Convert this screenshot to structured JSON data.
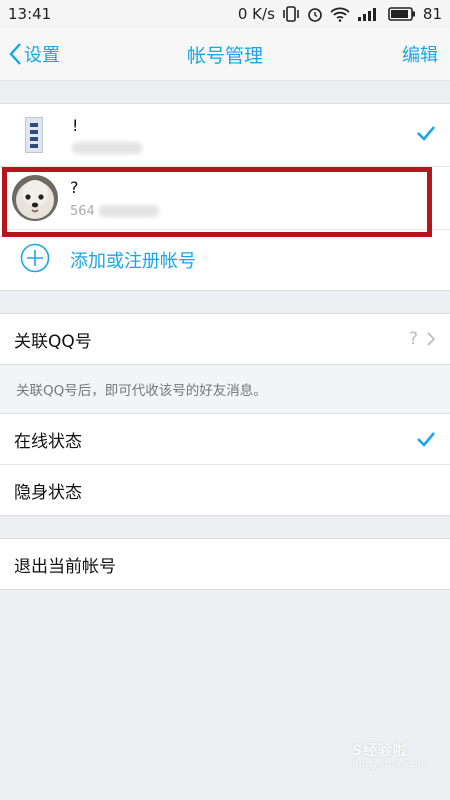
{
  "status_bar": {
    "time": "13:41",
    "network_speed": "0 K/s",
    "battery": "81"
  },
  "nav": {
    "back_label": "设置",
    "title": "帐号管理",
    "edit_label": "编辑"
  },
  "accounts": [
    {
      "name": "!",
      "id": "",
      "selected": true
    },
    {
      "name": "?",
      "id": "564",
      "selected": false
    }
  ],
  "add_account_label": "添加或注册帐号",
  "linked_qq": {
    "label": "关联QQ号",
    "value": "?",
    "hint": "关联QQ号后，即可代收该号的好友消息。"
  },
  "status_options": [
    {
      "label": "在线状态",
      "selected": true
    },
    {
      "label": "隐身状态",
      "selected": false
    }
  ],
  "logout_label": "退出当前帐号",
  "watermark": {
    "text": "S经验啦",
    "sub": "jingyanla.com"
  },
  "colors": {
    "accent": "#1aa6e4",
    "highlight": "#b5161b"
  }
}
